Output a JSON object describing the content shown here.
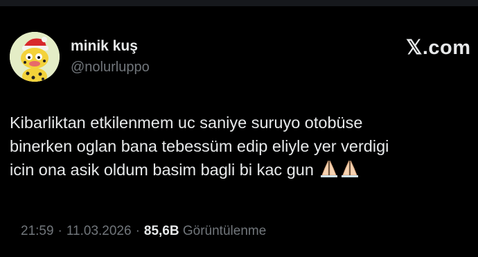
{
  "author": {
    "display_name": "minik kuş",
    "handle": "@nolurluppo"
  },
  "brand": {
    "label": ".com",
    "icon": "x-logo-icon"
  },
  "tweet": {
    "lines": [
      "Kibarliktan etkilenmem uc saniye suruyo otobüse",
      "binerken oglan bana tebessüm edip eliyle yer verdigi",
      "icin ona asik oldum basim bagli bi kac gun"
    ],
    "emojis": [
      "folded-hands-icon",
      "folded-hands-icon"
    ]
  },
  "meta": {
    "time": "21:59",
    "date": "11.03.2026",
    "views_count": "85,6B",
    "views_label": "Görüntülenme",
    "separator": "·"
  },
  "colors": {
    "background": "#000000",
    "primary_text": "#e7e9ea",
    "secondary_text": "#71767b"
  }
}
